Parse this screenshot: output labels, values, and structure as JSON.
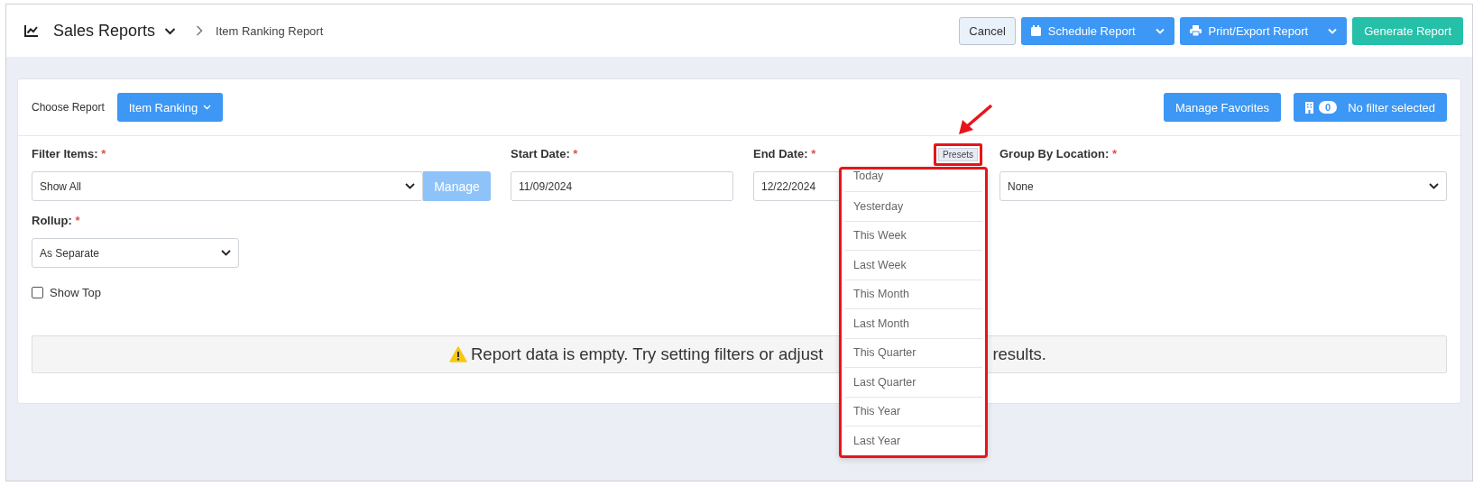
{
  "header": {
    "title": "Sales Reports",
    "breadcrumb": "Item Ranking Report",
    "buttons": [
      {
        "kind": "secondary",
        "label": "Cancel"
      },
      {
        "kind": "split",
        "label": "Schedule Report"
      },
      {
        "kind": "split",
        "label": "Print/Export Report"
      },
      {
        "kind": "success",
        "label": "Generate Report"
      }
    ]
  },
  "report_bar": {
    "label": "Choose Report",
    "report_button": "Item Ranking",
    "favorites_button": "Manage Favorites",
    "filter_button": {
      "count": "0",
      "label": "No filter selected"
    }
  },
  "form": {
    "filter_items": {
      "label": "Filter Items:",
      "required_mark": "*",
      "value": "Show All",
      "button": "Manage"
    },
    "start_date": {
      "label": "Start Date:",
      "required_mark": "*",
      "value": "11/09/2024"
    },
    "end_date": {
      "label": "End Date:",
      "required_mark": "*",
      "value": "12/22/2024",
      "presets_button": "Presets"
    },
    "group_by_location": {
      "label": "Group By Location:",
      "required_mark": "*",
      "value": "None"
    },
    "rollup": {
      "label": "Rollup:",
      "required_mark": "*",
      "value": "As Separate"
    },
    "show_top": {
      "label": "Show Top",
      "checked": false
    }
  },
  "presets_menu": [
    "Today",
    "Yesterday",
    "This Week",
    "Last Week",
    "This Month",
    "Last Month",
    "This Quarter",
    "Last Quarter",
    "This Year",
    "Last Year"
  ],
  "alert": {
    "text_start": "Report data is empty. Try setting filters or adjust",
    "text_end": "results."
  }
}
